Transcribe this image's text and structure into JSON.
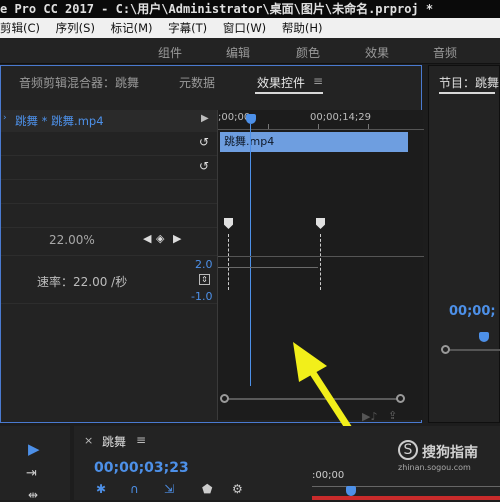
{
  "title": "e Pro CC 2017 - C:\\用户\\Administrator\\桌面\\图片\\未命名.prproj *",
  "menu": [
    "剪辑(C)",
    "序列(S)",
    "标记(M)",
    "字幕(T)",
    "窗口(W)",
    "帮助(H)"
  ],
  "workspaces": [
    "组件",
    "编辑",
    "颜色",
    "效果",
    "音频"
  ],
  "tabs": {
    "audio_mixer": "音频剪辑混合器：跳舞",
    "metadata": "元数据",
    "effect_controls": "效果控件",
    "menu_glyph": "≡"
  },
  "effect_controls": {
    "clip_path": "跳舞 * 跳舞.mp4",
    "timecode_start": ";00;00",
    "timecode_end": "00;00;14;29",
    "clip_label": "跳舞.mp4",
    "percent": "22.00%",
    "speed_value_top": "2.0",
    "speed_label": "速率：22.00 /秒",
    "speed_value_bottom": "-1.0"
  },
  "program": {
    "title": "节目：跳舞",
    "timecode": "00;00;"
  },
  "sequence": {
    "close": "×",
    "name": "跳舞",
    "menu_glyph": "≡",
    "timecode": "00;00;03;23",
    "ruler_start": ":00;00"
  },
  "watermark": {
    "brand": "搜狗指南",
    "url": "zhinan.sogou.com"
  },
  "colors": {
    "accent_blue": "#4d90e8",
    "clip_blue": "#6e9ee0",
    "arrow_yellow": "#f2ef1a",
    "panel_border_active": "#4a7ad0"
  }
}
